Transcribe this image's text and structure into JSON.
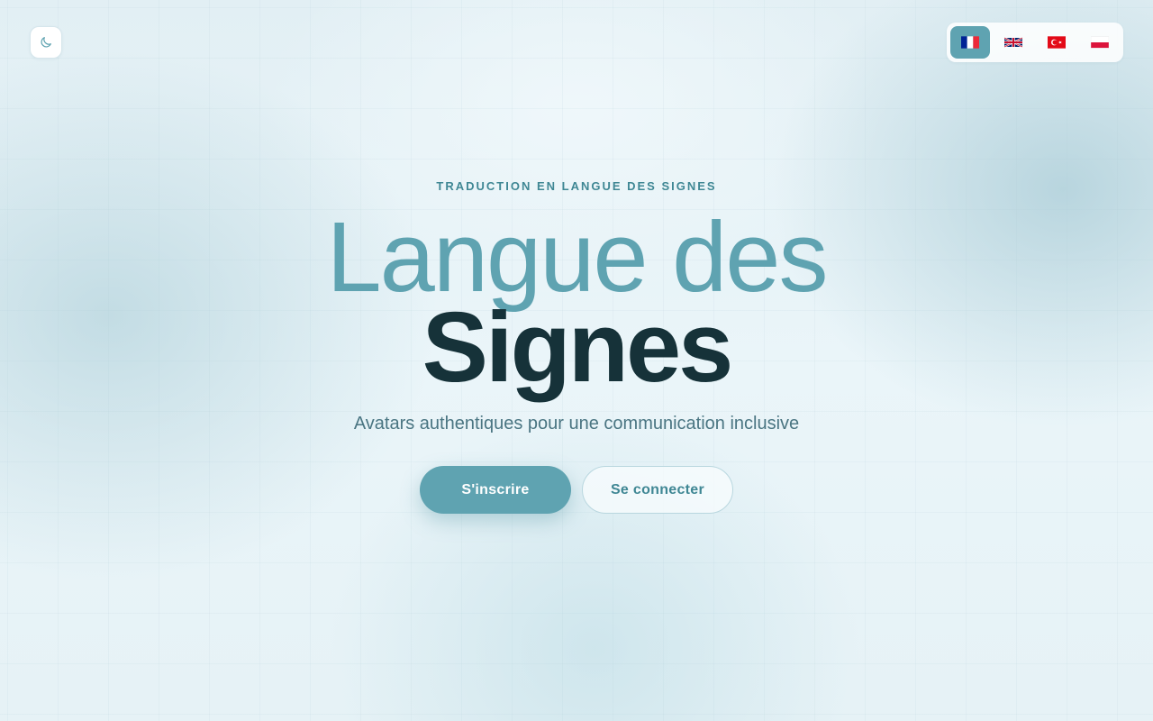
{
  "header": {
    "theme_toggle": {
      "icon": "moon-icon",
      "color": "#5fa3b1"
    },
    "languages": [
      {
        "code": "fr",
        "icon": "flag-france-icon",
        "active": true
      },
      {
        "code": "en",
        "icon": "flag-uk-icon",
        "active": false
      },
      {
        "code": "tr",
        "icon": "flag-turkey-icon",
        "active": false
      },
      {
        "code": "pl",
        "icon": "flag-poland-icon",
        "active": false
      }
    ]
  },
  "hero": {
    "eyebrow": "TRADUCTION EN LANGUE DES SIGNES",
    "title_light": "Langue des",
    "title_bold": "Signes",
    "subtitle": "Avatars authentiques pour une communication inclusive",
    "primary_button": "S'inscrire",
    "secondary_button": "Se connecter"
  },
  "colors": {
    "accent": "#5fa3b1",
    "dark_text": "#163239",
    "muted_text": "#4a7582",
    "background": "#e9f4f8"
  }
}
